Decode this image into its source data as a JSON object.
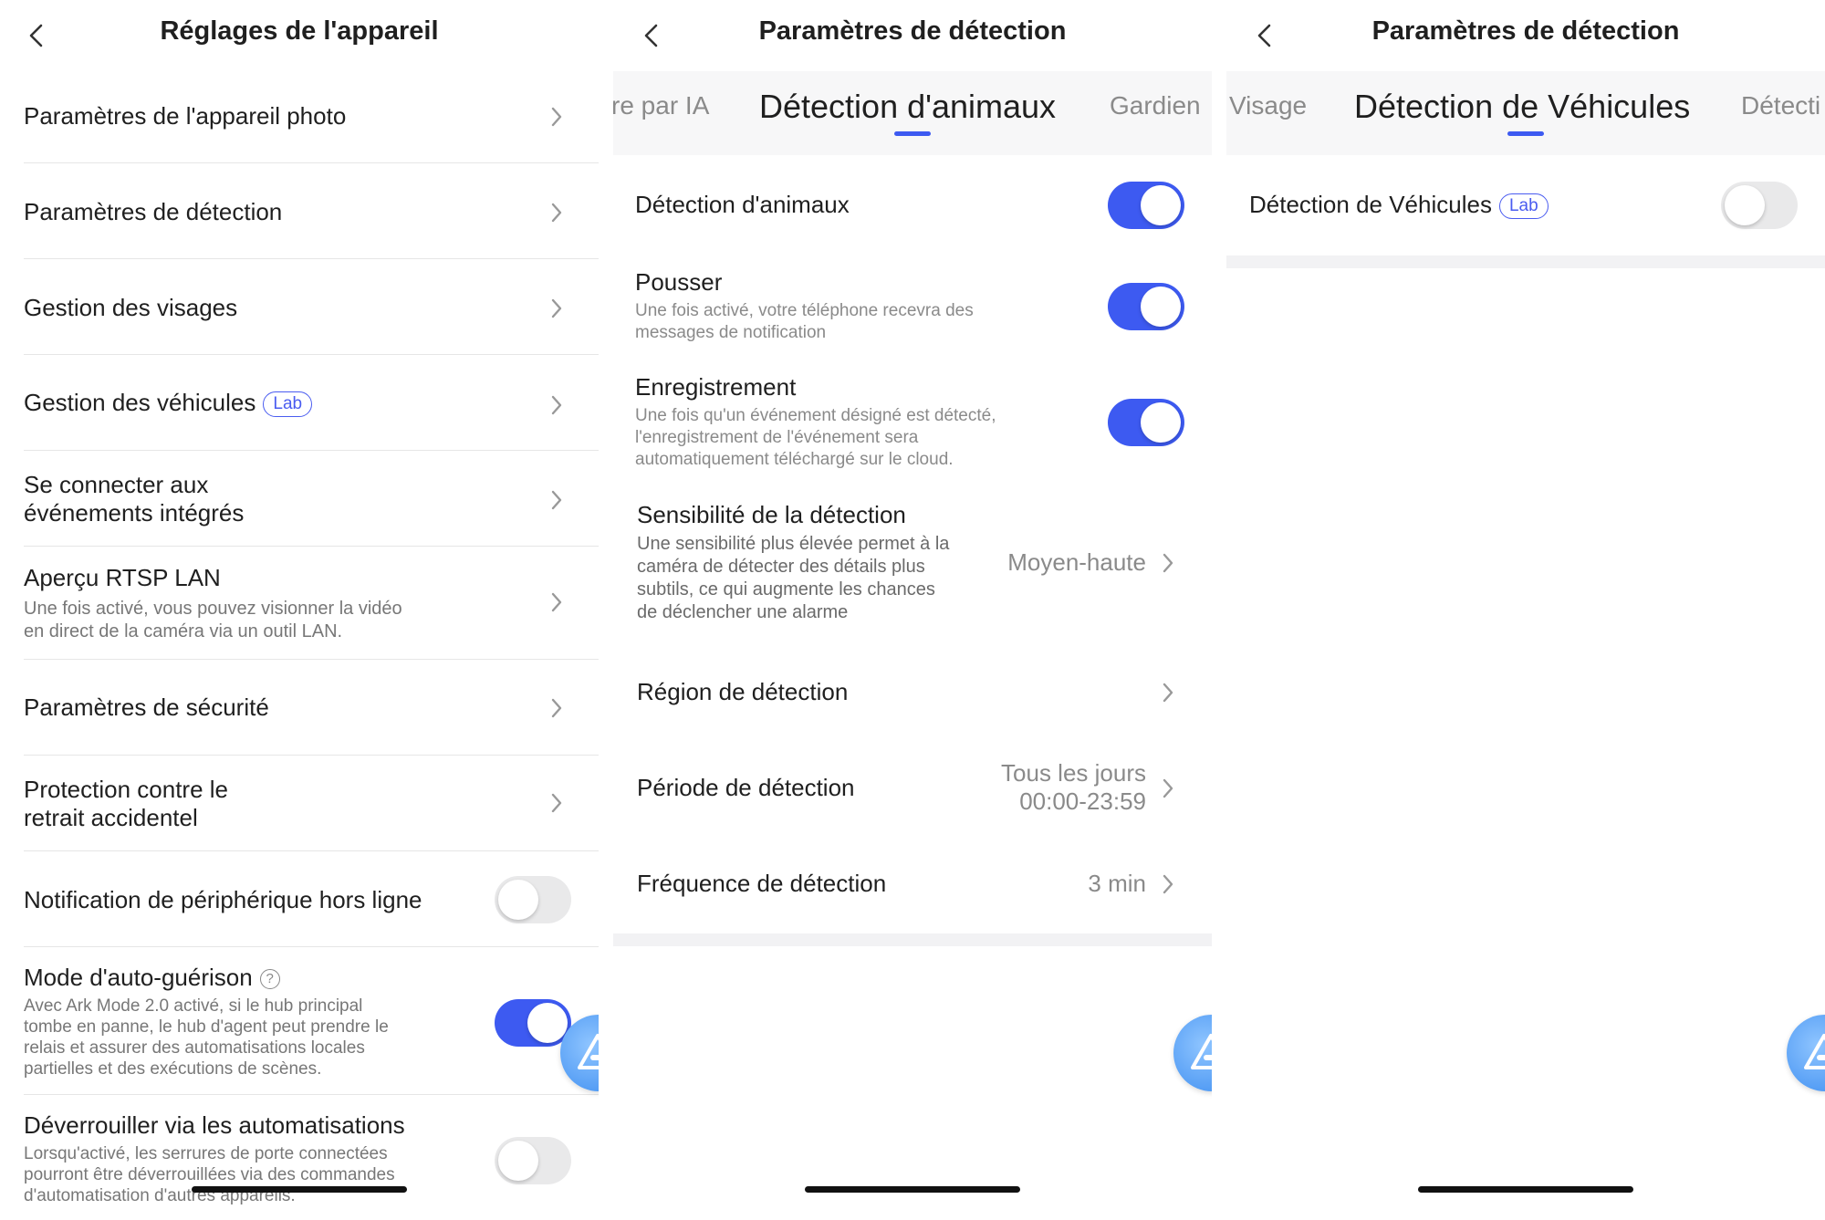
{
  "panel1": {
    "title": "Réglages de l'appareil",
    "rows": [
      {
        "label": "Paramètres de l'appareil photo"
      },
      {
        "label": "Paramètres de détection"
      },
      {
        "label": "Gestion des visages"
      },
      {
        "label": "Gestion des véhicules",
        "badge": "Lab"
      },
      {
        "label": "Se connecter aux\névénements intégrés"
      },
      {
        "label": "Aperçu RTSP LAN",
        "desc": "Une fois activé, vous pouvez visionner la vidéo\nen direct de la caméra via un outil LAN."
      },
      {
        "label": "Paramètres de sécurité"
      },
      {
        "label": "Protection contre le\nretrait accidentel"
      },
      {
        "label": "Notification de périphérique hors ligne",
        "toggle": false
      },
      {
        "label": "Mode d'auto-guérison",
        "help": "?",
        "desc": "Avec Ark Mode 2.0 activé, si le hub principal\ntombe en panne, le hub d'agent peut prendre le\nrelais et assurer des automatisations locales\npartielles et des exécutions de scènes.",
        "toggle": true
      },
      {
        "label": "Déverrouiller via les automatisations",
        "desc": "Lorsqu'activé, les serrures de porte connectées\npourront être déverrouillées via des commandes\nd'automatisation d'autres appareils.",
        "toggle": false
      }
    ]
  },
  "panel2": {
    "title": "Paramètres de détection",
    "tabs": {
      "left": "re par IA",
      "active": "Détection d'animaux",
      "right": "Gardien"
    },
    "rows": [
      {
        "label": "Détection d'animaux",
        "toggle": true
      },
      {
        "label": "Pousser",
        "desc": "Une fois activé, votre téléphone recevra des\nmessages de notification",
        "toggle": true
      },
      {
        "label": "Enregistrement",
        "desc": "Une fois qu'un événement désigné est détecté,\nl'enregistrement de l'événement sera\nautomatiquement téléchargé sur le cloud.",
        "toggle": true
      },
      {
        "label": "Sensibilité de la détection",
        "desc": "Une sensibilité plus élevée permet à la\ncaméra de détecter des détails plus\nsubtils, ce qui augmente les chances\nde déclencher une alarme",
        "value": "Moyen-haute"
      },
      {
        "label": "Région de détection"
      },
      {
        "label": "Période de détection",
        "value": "Tous les jours\n00:00-23:59"
      },
      {
        "label": "Fréquence de détection",
        "value": "3 min"
      }
    ]
  },
  "panel3": {
    "title": "Paramètres de détection",
    "tabs": {
      "left": "Visage",
      "active": "Détection de Véhicules",
      "right": "Détecti"
    },
    "rows": [
      {
        "label": "Détection de Véhicules",
        "badge": "Lab",
        "toggle": false
      }
    ]
  },
  "colors": {
    "accent": "#3d5af1",
    "toggle_off": "#e9e9ea",
    "lab_badge": "#4a5cf0"
  },
  "icons": [
    "chevron-left-icon",
    "chevron-right-icon",
    "help-circle-icon",
    "assistant-fab-icon"
  ]
}
